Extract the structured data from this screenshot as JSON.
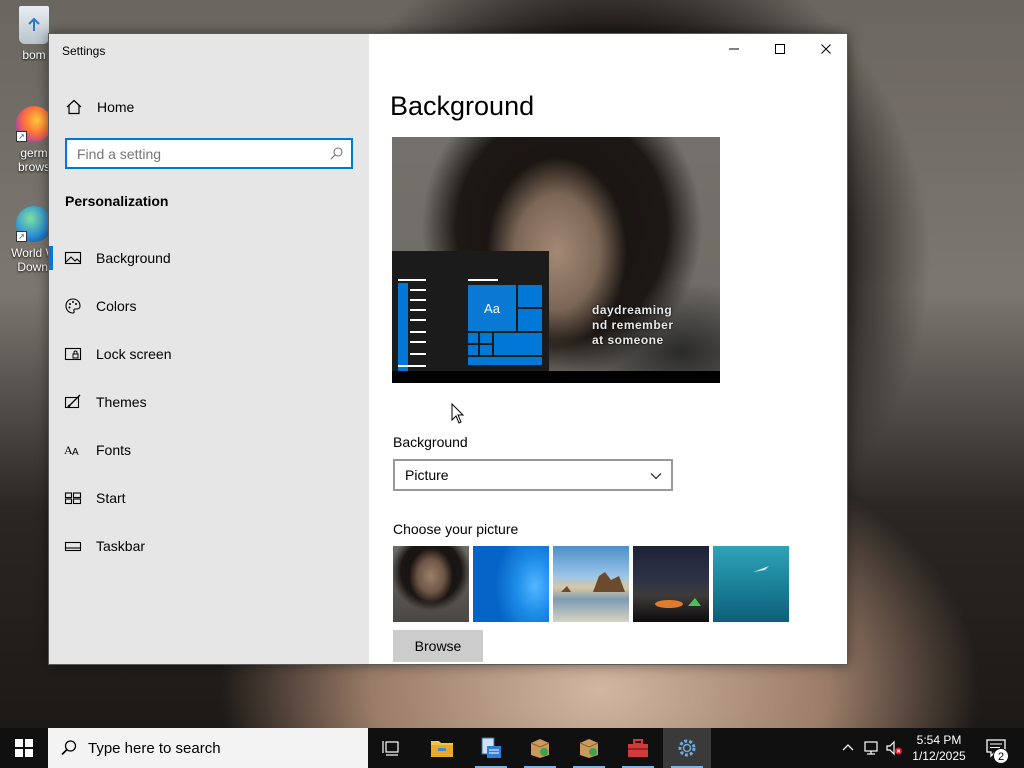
{
  "desktop": {
    "icons": [
      {
        "label": "bom",
        "icon": "recycle-bin-icon"
      },
      {
        "label": "germ\nbrows",
        "icon": "firefox-icon"
      },
      {
        "label": "World W\nDownl",
        "icon": "globe-icon"
      }
    ]
  },
  "window": {
    "title": "Settings",
    "caption": {
      "minimize": "minimize-icon",
      "maximize": "maximize-icon",
      "close": "close-icon"
    }
  },
  "sidebar": {
    "home_label": "Home",
    "search_placeholder": "Find a setting",
    "section_heading": "Personalization",
    "items": [
      {
        "label": "Background",
        "icon": "picture-icon",
        "selected": true
      },
      {
        "label": "Colors",
        "icon": "palette-icon"
      },
      {
        "label": "Lock screen",
        "icon": "lock-screen-icon"
      },
      {
        "label": "Themes",
        "icon": "themes-icon"
      },
      {
        "label": "Fonts",
        "icon": "fonts-icon"
      },
      {
        "label": "Start",
        "icon": "start-icon"
      },
      {
        "label": "Taskbar",
        "icon": "taskbar-icon"
      }
    ]
  },
  "content": {
    "page_title": "Background",
    "preview": {
      "tile_label": "Aa",
      "caption_lines": [
        "daydreaming",
        "nd remember",
        "at someone"
      ]
    },
    "background_label": "Background",
    "background_value": "Picture",
    "choose_label": "Choose your picture",
    "browse_label": "Browse"
  },
  "taskbar": {
    "search_placeholder": "Type here to search",
    "time": "5:54 PM",
    "date": "1/12/2025",
    "notification_count": "2",
    "accent": "#0078d7"
  }
}
